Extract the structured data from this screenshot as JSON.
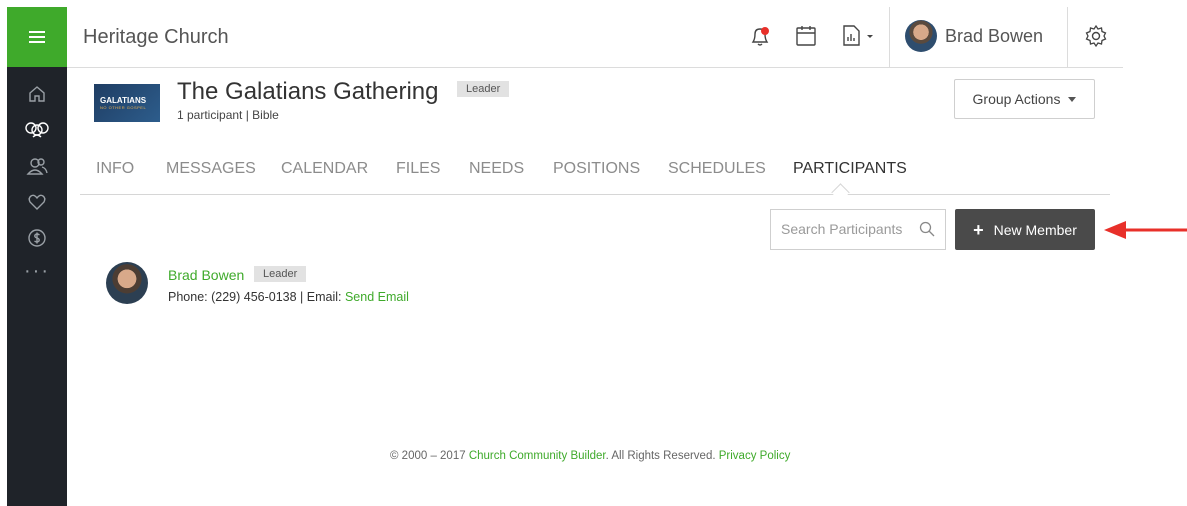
{
  "header": {
    "org_name": "Heritage Church",
    "user_name": "Brad Bowen",
    "icons": [
      "bell-icon",
      "calendar-icon",
      "report-icon",
      "gear-icon"
    ]
  },
  "rail": {
    "icons": [
      "menu-icon",
      "home-icon",
      "groups-icon",
      "people-icon",
      "heart-icon",
      "dollar-icon",
      "more-icon"
    ]
  },
  "group": {
    "thumb_title": "GALATIANS",
    "thumb_sub": "NO OTHER GOSPEL",
    "title": "The Galatians Gathering",
    "badge": "Leader",
    "subtitle": "1 participant | Bible",
    "actions_label": "Group Actions"
  },
  "tabs": [
    "INFO",
    "MESSAGES",
    "CALENDAR",
    "FILES",
    "NEEDS",
    "POSITIONS",
    "SCHEDULES",
    "PARTICIPANTS"
  ],
  "active_tab": "PARTICIPANTS",
  "search": {
    "placeholder": "Search Participants"
  },
  "new_member_label": "New Member",
  "participants": [
    {
      "name": "Brad Bowen",
      "badge": "Leader",
      "phone_text": "Phone: (229) 456-0138 | Email: ",
      "email_link": "Send Email"
    }
  ],
  "footer": {
    "prefix": "© 2000 – 2017 ",
    "company": "Church Community Builder",
    "middle": ". All Rights Reserved. ",
    "privacy": "Privacy Policy"
  },
  "colors": {
    "accent_green": "#3faa2b",
    "rail_bg": "#1f2329",
    "button_dark": "#4a4a4a",
    "arrow_red": "#e8302a"
  }
}
